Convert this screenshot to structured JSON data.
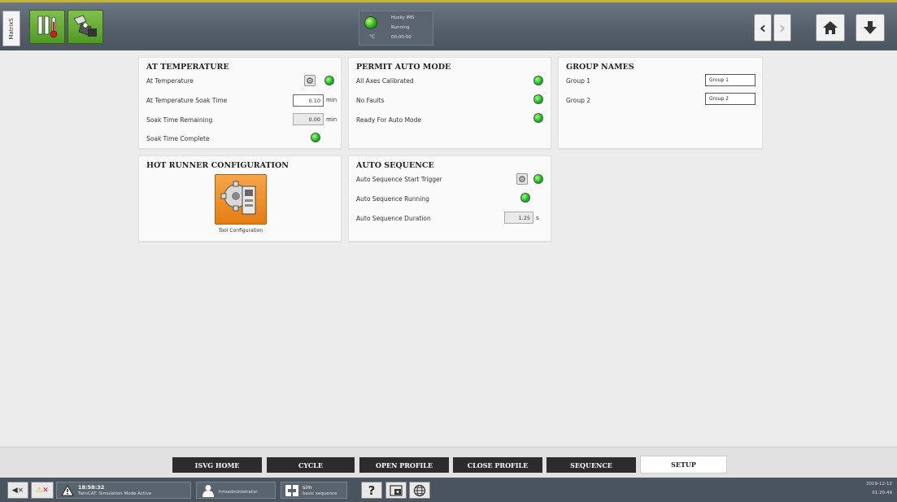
{
  "app": {
    "side_tab": "MatrixS",
    "brand_accent": "#c9b23a"
  },
  "status": {
    "system": "Husky IMS",
    "state": "Running",
    "unit": "°C",
    "time": "00:00:00",
    "led_color": "#23a71d"
  },
  "nav": {
    "back_icon": "chevron-left-icon",
    "forward_icon": "chevron-right-icon",
    "home_icon": "home-icon",
    "download_icon": "arrow-down-icon"
  },
  "at_temperature": {
    "title": "AT TEMPERATURE",
    "rows": [
      {
        "label": "At Temperature"
      },
      {
        "label": "At Temperature Soak Time",
        "value": "0.10",
        "unit": "min"
      },
      {
        "label": "Soak Time Remaining",
        "value": "0.00",
        "unit": "min"
      },
      {
        "label": "Soak Time Complete"
      }
    ]
  },
  "permit_auto_mode": {
    "title": "PERMIT AUTO MODE",
    "rows": [
      {
        "label": "All Axes Calibrated"
      },
      {
        "label": "No Faults"
      },
      {
        "label": "Ready For Auto Mode"
      }
    ]
  },
  "group_names": {
    "title": "GROUP NAMES",
    "rows": [
      {
        "label": "Group 1",
        "value": "Group 1"
      },
      {
        "label": "Group 2",
        "value": "Group 2"
      }
    ]
  },
  "hot_runner": {
    "title": "HOT RUNNER CONFIGURATION",
    "tool_label": "Tool Configuration"
  },
  "auto_sequence": {
    "title": "AUTO SEQUENCE",
    "rows": [
      {
        "label": "Auto Sequence Start Trigger"
      },
      {
        "label": "Auto Sequence Running"
      },
      {
        "label": "Auto Sequence Duration",
        "value": "1.25",
        "unit": "s"
      }
    ]
  },
  "tabs": [
    {
      "label": "ISVG HOME"
    },
    {
      "label": "CYCLE"
    },
    {
      "label": "OPEN PROFILE"
    },
    {
      "label": "CLOSE PROFILE"
    },
    {
      "label": "SEQUENCE"
    },
    {
      "label": "SETUP",
      "active": true
    }
  ],
  "statusbar": {
    "alarm_time": "18:58:32",
    "alarm_text": "TwinCAT: Simulation Mode Active",
    "user": "hmiadministrator",
    "mode_title": "sim",
    "mode_sub": "basic sequence",
    "date": "2019-12-12",
    "clock": "01:20:49"
  }
}
